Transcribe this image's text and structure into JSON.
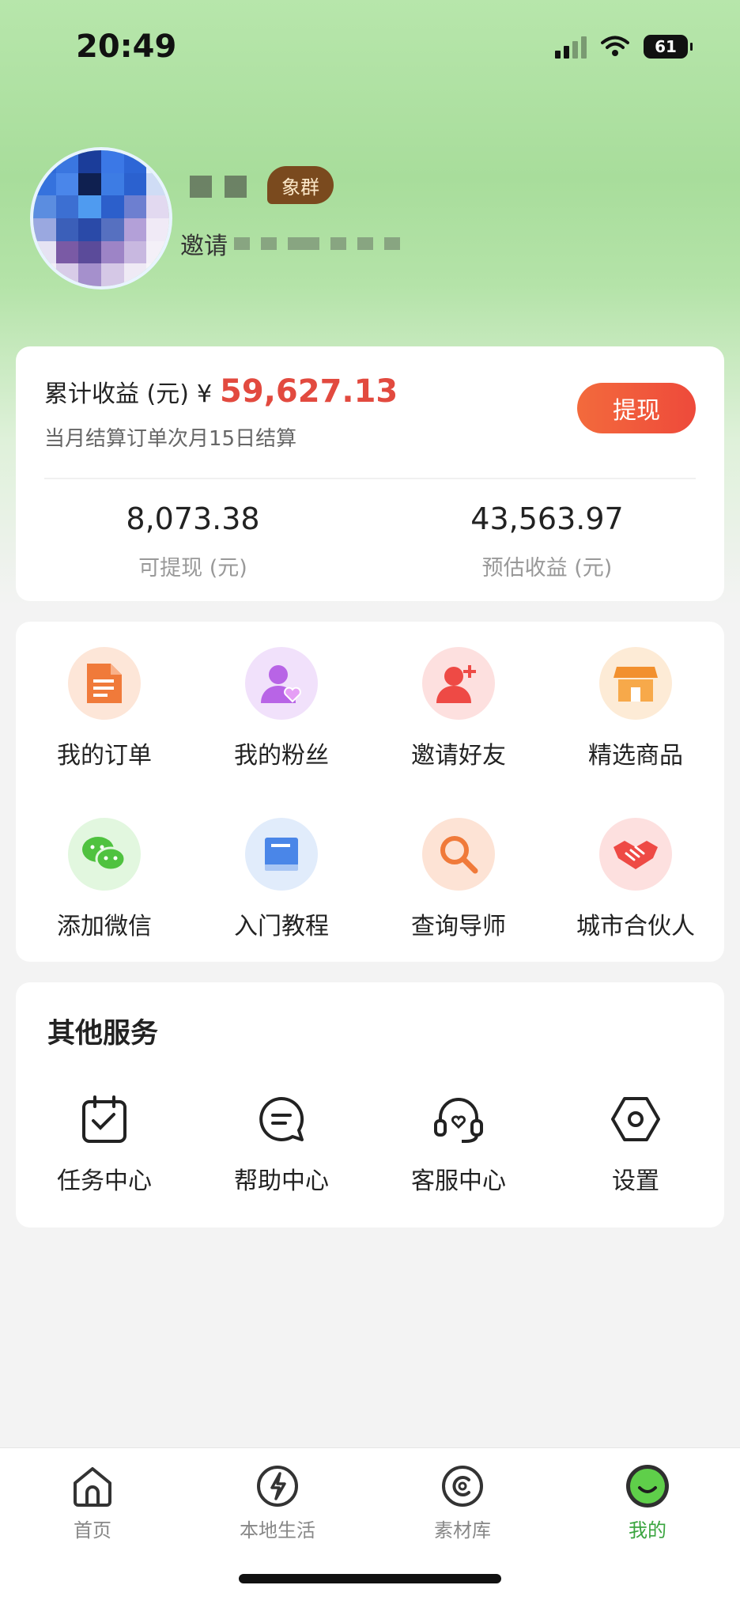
{
  "status_bar": {
    "time": "20:49",
    "battery": "61"
  },
  "profile": {
    "tag": "象群",
    "invite_prefix": "邀请"
  },
  "earnings": {
    "title": "累计收益 (元)",
    "currency": "¥",
    "amount": "59,627.13",
    "note": "当月结算订单次月15日结算",
    "withdraw_label": "提现",
    "withdrawable": {
      "value": "8,073.38",
      "label": "可提现 (元)"
    },
    "estimated": {
      "value": "43,563.97",
      "label": "预估收益 (元)"
    }
  },
  "features": [
    {
      "label": "我的订单",
      "icon": "order-document-icon"
    },
    {
      "label": "我的粉丝",
      "icon": "fans-heart-icon"
    },
    {
      "label": "邀请好友",
      "icon": "add-friend-icon"
    },
    {
      "label": "精选商品",
      "icon": "store-icon"
    },
    {
      "label": "添加微信",
      "icon": "wechat-icon"
    },
    {
      "label": "入门教程",
      "icon": "book-icon"
    },
    {
      "label": "查询导师",
      "icon": "search-icon"
    },
    {
      "label": "城市合伙人",
      "icon": "handshake-icon"
    }
  ],
  "services": {
    "title": "其他服务",
    "items": [
      {
        "label": "任务中心",
        "icon": "task-calendar-icon"
      },
      {
        "label": "帮助中心",
        "icon": "help-chat-icon"
      },
      {
        "label": "客服中心",
        "icon": "headset-icon"
      },
      {
        "label": "设置",
        "icon": "settings-hexagon-icon"
      }
    ]
  },
  "tabbar": [
    {
      "label": "首页",
      "icon": "home-icon",
      "active": false
    },
    {
      "label": "本地生活",
      "icon": "lightning-icon",
      "active": false
    },
    {
      "label": "素材库",
      "icon": "material-icon",
      "active": false
    },
    {
      "label": "我的",
      "icon": "profile-smile-icon",
      "active": true
    }
  ],
  "colors": {
    "accent_red": "#e24a3f",
    "active_green": "#3aa53f"
  }
}
